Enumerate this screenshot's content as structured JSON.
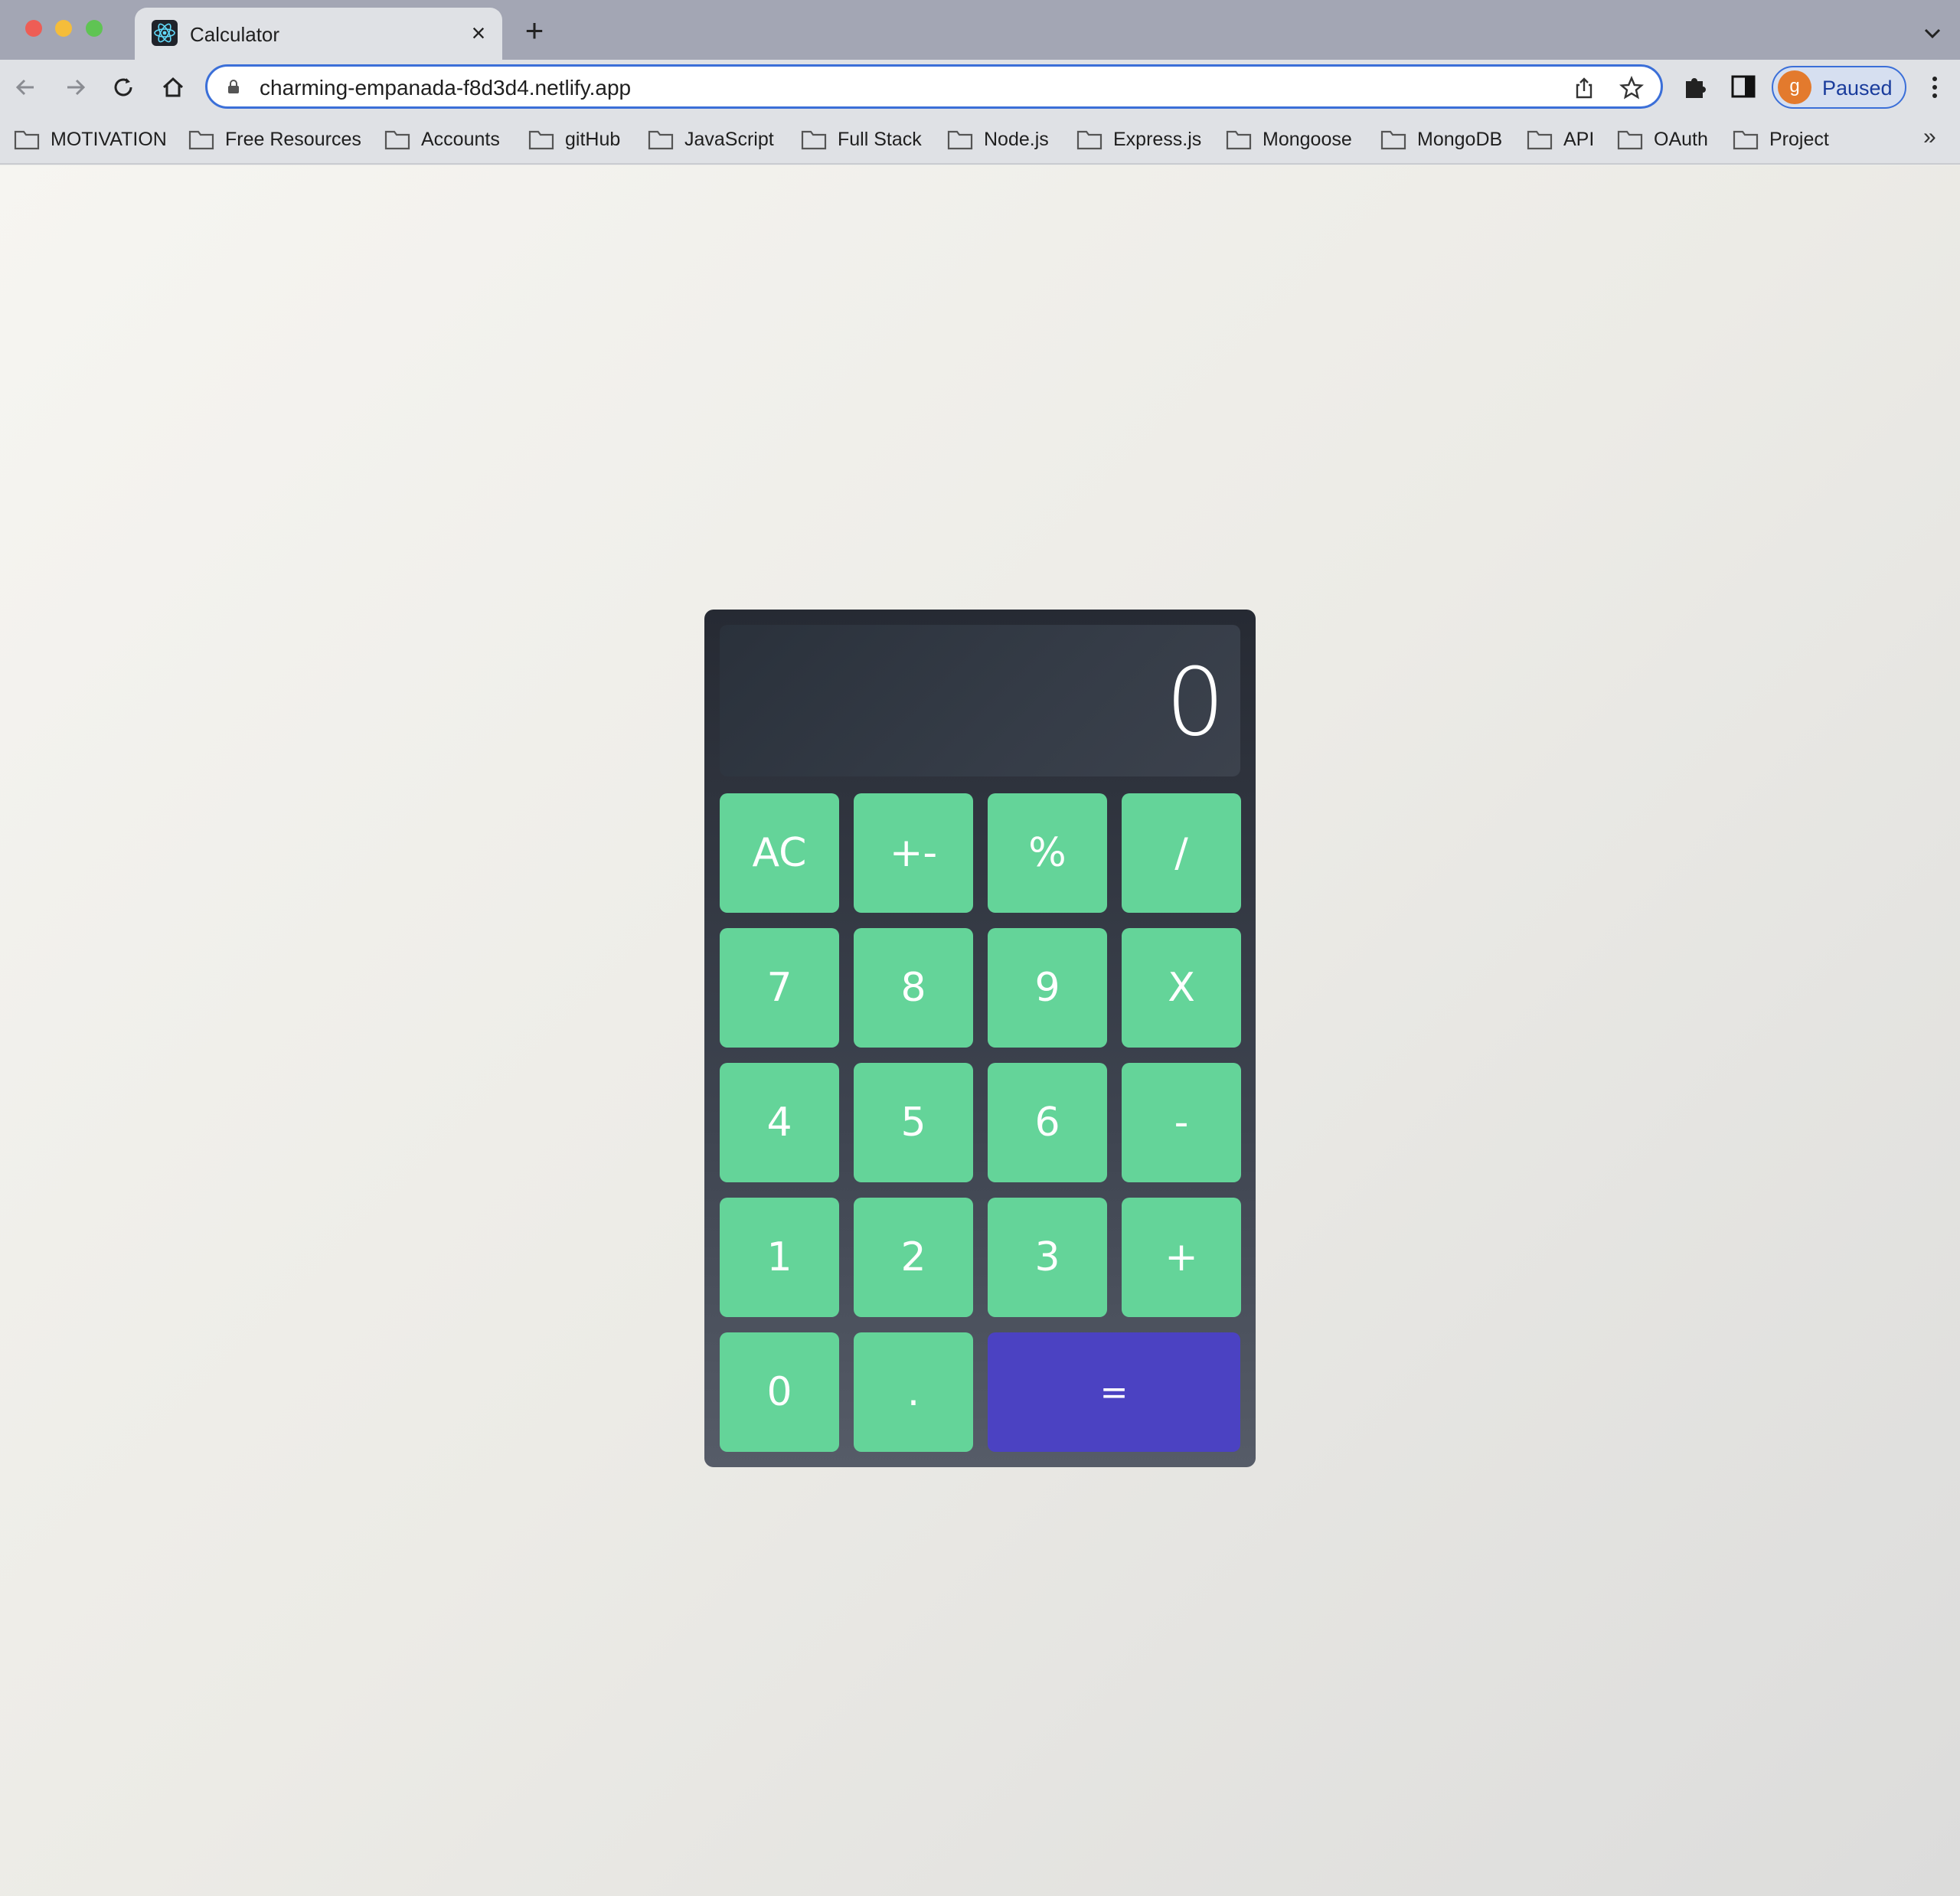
{
  "browser": {
    "tab_title": "Calculator",
    "tab_close": "×",
    "new_tab": "+",
    "url": "charming-empanada-f8d3d4.netlify.app",
    "profile_initial": "g",
    "profile_status": "Paused",
    "bookmarks_overflow": "»"
  },
  "bookmarks": [
    {
      "label": "MOTIVATION"
    },
    {
      "label": "Free Resources"
    },
    {
      "label": "Accounts"
    },
    {
      "label": "gitHub"
    },
    {
      "label": "JavaScript"
    },
    {
      "label": "Full Stack"
    },
    {
      "label": "Node.js"
    },
    {
      "label": "Express.js"
    },
    {
      "label": "Mongoose"
    },
    {
      "label": "MongoDB"
    },
    {
      "label": "API"
    },
    {
      "label": "OAuth"
    },
    {
      "label": "Project"
    }
  ],
  "calculator": {
    "display": "0",
    "keys": [
      "AC",
      "+-",
      "%",
      "/",
      "7",
      "8",
      "9",
      "X",
      "4",
      "5",
      "6",
      "-",
      "1",
      "2",
      "3",
      "+",
      "0",
      ".",
      "="
    ]
  },
  "colors": {
    "key_green": "#64d499",
    "equals_purple": "#4b42c2",
    "body_dark": "#262a33"
  }
}
